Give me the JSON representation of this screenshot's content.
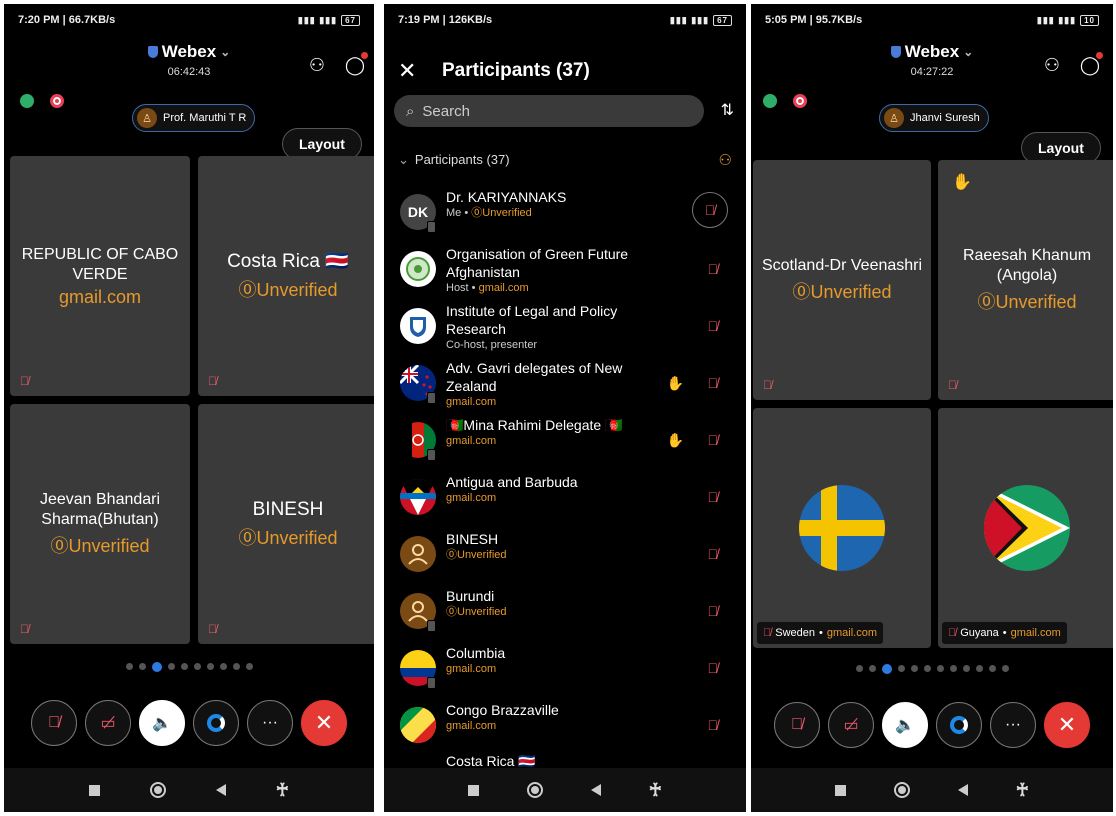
{
  "screen1": {
    "status": {
      "time": "7:20 PM | 66.7KB/s",
      "battery": "67"
    },
    "app_title": "Webex",
    "timer": "06:42:43",
    "active_speaker": "Prof. Maruthi T R",
    "layout_label": "Layout",
    "tiles": [
      {
        "name": "REPUBLIC OF CABO VERDE",
        "sub": "gmail.com"
      },
      {
        "name": "Costa Rica 🇨🇷",
        "sub": "⓪Unverified"
      },
      {
        "name": "Jeevan Bhandari Sharma(Bhutan)",
        "sub": "⓪Unverified"
      },
      {
        "name": "BINESH",
        "sub": "⓪Unverified"
      }
    ],
    "pager": {
      "count": 10,
      "active": 2
    }
  },
  "screen2": {
    "status": {
      "time": "7:19 PM | 126KB/s",
      "battery": "67"
    },
    "title": "Participants (37)",
    "search_placeholder": "Search",
    "section_label": "Participants (37)",
    "participants": [
      {
        "name": "Dr. KARIYANNAKS",
        "initials": "DK",
        "sub_plain": "Me • ",
        "sub_accent": "⓪Unverified",
        "avatar": "initials",
        "device": true,
        "raised": false,
        "mic_circle": true
      },
      {
        "name": "Organisation of Green Future Afghanistan",
        "sub_plain": "Host • ",
        "sub_accent": "gmail.com",
        "avatar": "logo-green",
        "device": false,
        "raised": false
      },
      {
        "name": "Institute of Legal and Policy Research",
        "sub_plain": "Co-host, presenter",
        "sub_accent": "",
        "avatar": "logo-blue",
        "device": false,
        "raised": false
      },
      {
        "name": "Adv. Gavri delegates of New Zealand",
        "sub_plain": "",
        "sub_accent": "gmail.com",
        "avatar": "flag-nz",
        "device": true,
        "raised": true
      },
      {
        "name": "🇦🇫Mina Rahimi Delegate 🇦🇫",
        "sub_plain": "",
        "sub_accent": "gmail.com",
        "avatar": "flag-af",
        "device": true,
        "raised": true
      },
      {
        "name": "Antigua and Barbuda",
        "sub_plain": "",
        "sub_accent": "gmail.com",
        "avatar": "flag-ag",
        "device": false,
        "raised": false
      },
      {
        "name": "BINESH",
        "sub_plain": "",
        "sub_accent": "⓪Unverified",
        "avatar": "person",
        "device": false,
        "raised": false
      },
      {
        "name": "Burundi",
        "sub_plain": "",
        "sub_accent": "⓪Unverified",
        "avatar": "person",
        "device": true,
        "raised": false
      },
      {
        "name": "Columbia",
        "sub_plain": "",
        "sub_accent": "gmail.com",
        "avatar": "flag-co",
        "device": true,
        "raised": false
      },
      {
        "name": "Congo Brazzaville",
        "sub_plain": "",
        "sub_accent": "gmail.com",
        "avatar": "flag-cg",
        "device": false,
        "raised": false
      }
    ],
    "partial_row": "Costa Rica 🇨🇷"
  },
  "screen3": {
    "status": {
      "time": "5:05 PM | 95.7KB/s",
      "battery": "10"
    },
    "app_title": "Webex",
    "timer": "04:27:22",
    "active_speaker": "Jhanvi Suresh",
    "layout_label": "Layout",
    "tiles": [
      {
        "name": "Scotland-Dr Veenashri",
        "sub": "⓪Unverified"
      },
      {
        "name": "Raeesah Khanum (Angola)",
        "sub": "⓪Unverified"
      }
    ],
    "video_tiles": [
      {
        "name": "Sweden",
        "sub": "gmail.com"
      },
      {
        "name": "Guyana",
        "sub": "gmail.com"
      }
    ],
    "pager": {
      "count": 12,
      "active": 2
    }
  },
  "colors": {
    "accent_orange": "#e69a2c",
    "mute_red": "#ef5a6a",
    "end_red": "#e53935",
    "webex_blue": "#2d7be0"
  }
}
